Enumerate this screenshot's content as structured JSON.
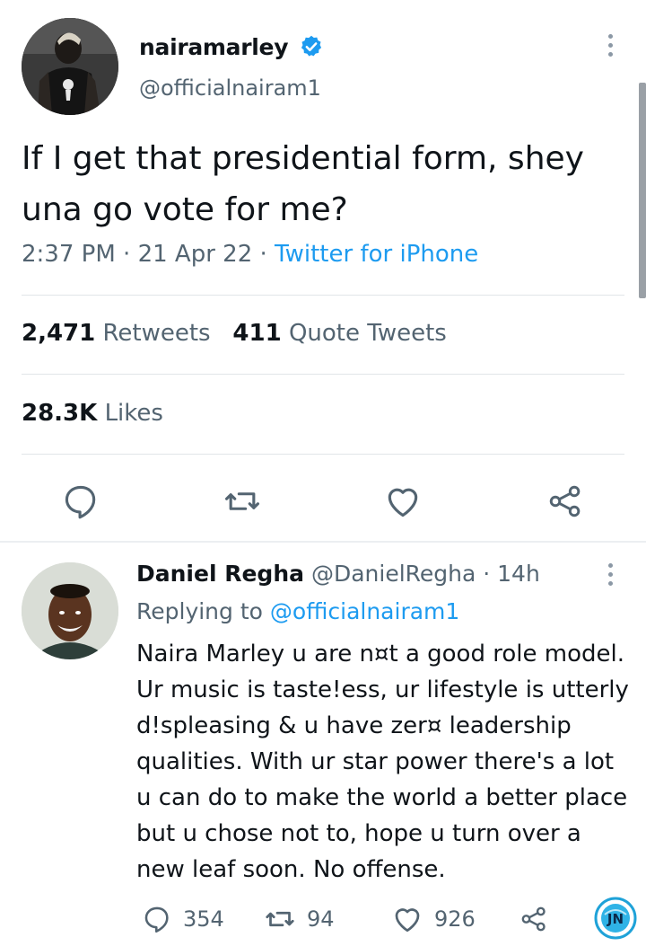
{
  "main_tweet": {
    "author_name": "nairamarley",
    "author_handle": "@officialnairam1",
    "text": "If I get that presidential form, shey una go vote for me?",
    "time": "2:37 PM",
    "date": "21 Apr 22",
    "source": "Twitter for iPhone",
    "retweets_count": "2,471",
    "retweets_label": "Retweets",
    "quotes_count": "411",
    "quotes_label": "Quote Tweets",
    "likes_count": "28.3K",
    "likes_label": "Likes"
  },
  "reply": {
    "author_name": "Daniel Regha",
    "author_handle": "@DanielRegha",
    "age": "14h",
    "replying_label": "Replying to",
    "replying_to": "@officialnairam1",
    "text": "Naira Marley u are n¤t a good role model. Ur music is taste!ess, ur lifestyle is utterly d!spleasing & u have zer¤ leadership qualities. With ur star power there's a lot u can do to make the world a better place but u chose not to, hope u turn over a new leaf soon. No offense.",
    "replies_count": "354",
    "retweets_count": "94",
    "likes_count": "926"
  },
  "icons": {
    "reply": "reply-icon",
    "retweet": "retweet-icon",
    "like": "heart-icon",
    "share": "share-icon",
    "more": "more-vertical-icon",
    "verified": "verified-badge-icon"
  },
  "watermark": "JN",
  "colors": {
    "text": "#0f1419",
    "secondary": "#536471",
    "link": "#1d9bf0",
    "verified": "#1d9bf0",
    "divider": "#e1e5e8"
  }
}
